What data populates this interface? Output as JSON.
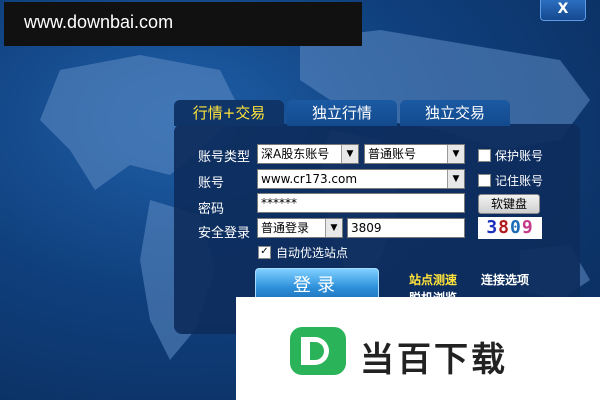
{
  "watermark_top": "www.downbai.com",
  "window": {
    "close_label": "X"
  },
  "tabs": [
    {
      "label": "行情+交易"
    },
    {
      "label": "独立行情"
    },
    {
      "label": "独立交易"
    }
  ],
  "form": {
    "account_type_label": "账号类型",
    "account_type_value": "深A股东账号",
    "account_kind_value": "普通账号",
    "protect_account_label": "保护账号",
    "account_label": "账号",
    "account_value": "www.cr173.com",
    "remember_account_label": "记住账号",
    "password_label": "密码",
    "password_value": "******",
    "soft_keyboard_label": "软键盘",
    "security_login_label": "安全登录",
    "security_login_value": "普通登录",
    "captcha_input_value": "3809",
    "captcha_image_text": "3809",
    "auto_site_label": "自动优选站点"
  },
  "login_button": "登录",
  "links": {
    "site_test": "站点测速",
    "offline_browse": "脱机浏览",
    "connection_options": "连接选项"
  },
  "watermark_bottom": {
    "text": "当百下载"
  },
  "colors": {
    "accent_yellow": "#ffe33a",
    "brand_green": "#2bb35a"
  }
}
